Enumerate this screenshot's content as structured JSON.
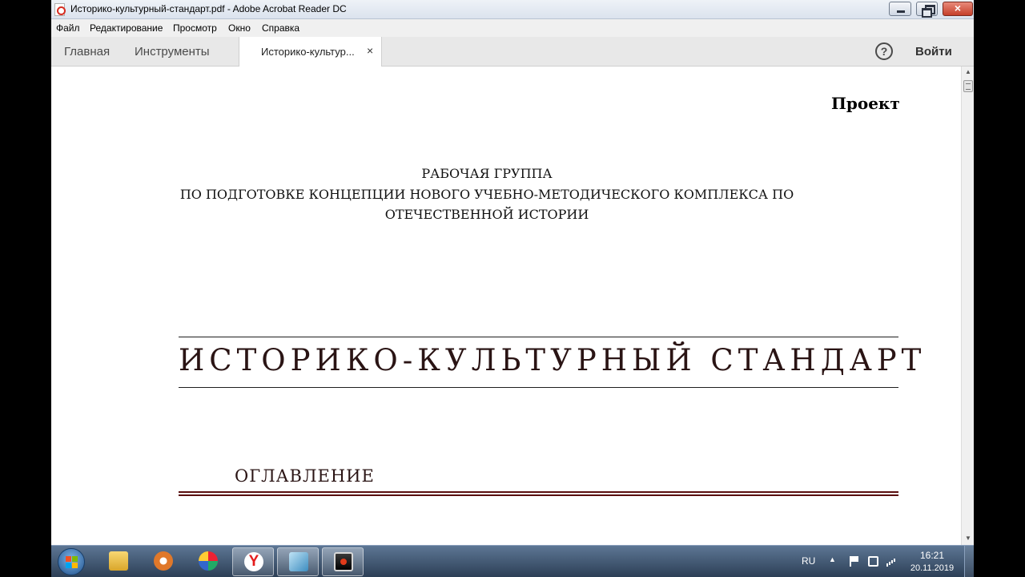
{
  "window": {
    "title": "Историко-культурный-стандарт.pdf - Adobe Acrobat Reader DC",
    "close_glyph": "×"
  },
  "menu": {
    "items": [
      "Файл",
      "Редактирование",
      "Просмотр",
      "Окно",
      "Справка"
    ]
  },
  "tabs": {
    "home": "Главная",
    "tools": "Инструменты",
    "document": "Историко-культур...",
    "document_close": "×",
    "help_glyph": "?",
    "sign_in": "Войти"
  },
  "document": {
    "project_label": "Проект",
    "working_group": [
      "РАБОЧАЯ ГРУППА",
      "ПО ПОДГОТОВКЕ КОНЦЕПЦИИ НОВОГО УЧЕБНО-МЕТОДИЧЕСКОГО КОМПЛЕКСА ПО",
      "ОТЕЧЕСТВЕННОЙ ИСТОРИИ"
    ],
    "main_title": "ИСТОРИКО-КУЛЬТУРНЫЙ СТАНДАРТ",
    "toc_heading": "ОГЛАВЛЕНИЕ"
  },
  "scrollbar": {
    "up_glyph": "▲",
    "down_glyph": "▼"
  },
  "taskbar": {
    "apps": [
      {
        "name": "folder-icon"
      },
      {
        "name": "media-player-icon"
      },
      {
        "name": "paint-icon"
      },
      {
        "name": "yandex-browser-icon",
        "glyph": "Y"
      },
      {
        "name": "notepad-icon"
      },
      {
        "name": "screen-recorder-icon"
      }
    ],
    "language": "RU",
    "tray_arrow": "▲",
    "time": "16:21",
    "date": "20.11.2019"
  }
}
